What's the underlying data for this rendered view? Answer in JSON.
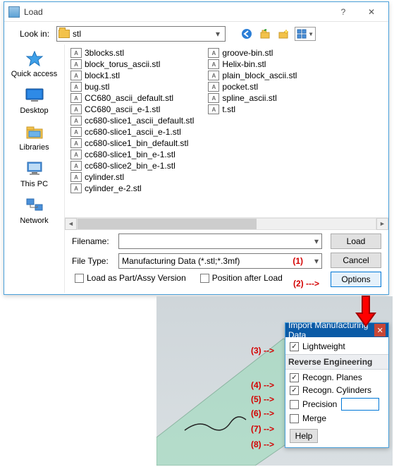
{
  "window": {
    "title": "Load",
    "lookin_label": "Look in:",
    "lookin_value": "stl"
  },
  "sidebar": [
    {
      "id": "quick-access",
      "label": "Quick access"
    },
    {
      "id": "desktop",
      "label": "Desktop"
    },
    {
      "id": "libraries",
      "label": "Libraries"
    },
    {
      "id": "this-pc",
      "label": "This PC"
    },
    {
      "id": "network",
      "label": "Network"
    }
  ],
  "filesCol1": [
    "3blocks.stl",
    "block_torus_ascii.stl",
    "block1.stl",
    "bug.stl",
    "CC680_ascii_default.stl",
    "CC680_ascii_e-1.stl",
    "cc680-slice1_ascii_default.stl",
    "cc680-slice1_ascii_e-1.stl",
    "cc680-slice1_bin_default.stl",
    "cc680-slice1_bin_e-1.stl",
    "cc680-slice2_bin_e-1.stl",
    "cylinder.stl",
    "cylinder_e-2.stl"
  ],
  "filesCol2": [
    "groove-bin.stl",
    "Helix-bin.stl",
    "plain_block_ascii.stl",
    "pocket.stl",
    "spline_ascii.stl",
    "t.stl"
  ],
  "form": {
    "filename_label": "Filename:",
    "filename_value": "",
    "filetype_label": "File Type:",
    "filetype_value": "Manufacturing Data (*.stl;*.3mf)",
    "load_btn": "Load",
    "cancel_btn": "Cancel",
    "options_btn": "Options",
    "chk_loadpart": "Load as Part/Assy Version",
    "chk_position": "Position after Load"
  },
  "annotations": {
    "a1": "(1)",
    "a2": "(2) --->",
    "a3": "(3) -->",
    "a4": "(4) -->",
    "a5": "(5) -->",
    "a6": "(6) -->",
    "a7": "(7) -->",
    "a8": "(8) -->"
  },
  "popup": {
    "title": "Import Manufacturing Data",
    "lightweight": "Lightweight",
    "group": "Reverse Engineering",
    "recogn_planes": "Recogn. Planes",
    "recogn_cyls": "Recogn. Cylinders",
    "precision": "Precision",
    "precision_value": "",
    "merge": "Merge",
    "help": "Help"
  }
}
